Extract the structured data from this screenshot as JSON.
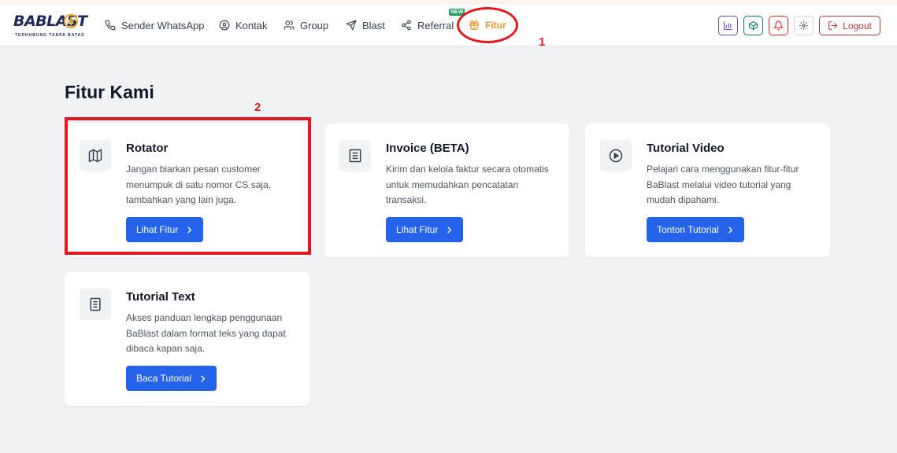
{
  "brand": {
    "name": "BABLAST",
    "tagline": "TERHUBUNG TANPA BATAS"
  },
  "nav": {
    "items": [
      {
        "label": "Sender WhatsApp",
        "icon": "phone-icon"
      },
      {
        "label": "Kontak",
        "icon": "user-circle-icon"
      },
      {
        "label": "Group",
        "icon": "users-icon"
      },
      {
        "label": "Blast",
        "icon": "send-icon"
      },
      {
        "label": "Referral",
        "icon": "share-icon",
        "badge": "NEW"
      },
      {
        "label": "Fitur",
        "icon": "gift-icon",
        "active": true
      }
    ],
    "actions": [
      {
        "name": "stats-icon",
        "color": "#6b46c1"
      },
      {
        "name": "box-icon",
        "color": "#0f766e"
      },
      {
        "name": "bell-icon",
        "color": "#dc2626"
      },
      {
        "name": "gear-icon",
        "color": "#374151"
      }
    ],
    "logout_label": "Logout"
  },
  "annotations": {
    "step1": "1",
    "step2": "2"
  },
  "page": {
    "title": "Fitur Kami"
  },
  "cards": [
    {
      "title": "Rotator",
      "description": "Jangan biarkan pesan customer menumpuk di satu nomor CS saja, tambahkan yang lain juga.",
      "button": "Lihat Fitur",
      "icon": "map-icon"
    },
    {
      "title": "Invoice (BETA)",
      "description": "Kirim dan kelola faktur secara otomatis untuk memudahkan pencatatan transaksi.",
      "button": "Lihat Fitur",
      "icon": "receipt-icon"
    },
    {
      "title": "Tutorial Video",
      "description": "Pelajari cara menggunakan fitur-fitur BaBlast melalui video tutorial yang mudah dipahami.",
      "button": "Tonton Tutorial",
      "icon": "play-circle-icon"
    },
    {
      "title": "Tutorial Text",
      "description": "Akses panduan lengkap penggunaan BaBlast dalam format teks yang dapat dibaca kapan saja.",
      "button": "Baca Tutorial",
      "icon": "document-icon"
    }
  ],
  "colors": {
    "accent": "#2563eb",
    "active_nav": "#f0932b",
    "annotation": "#e3191f"
  }
}
